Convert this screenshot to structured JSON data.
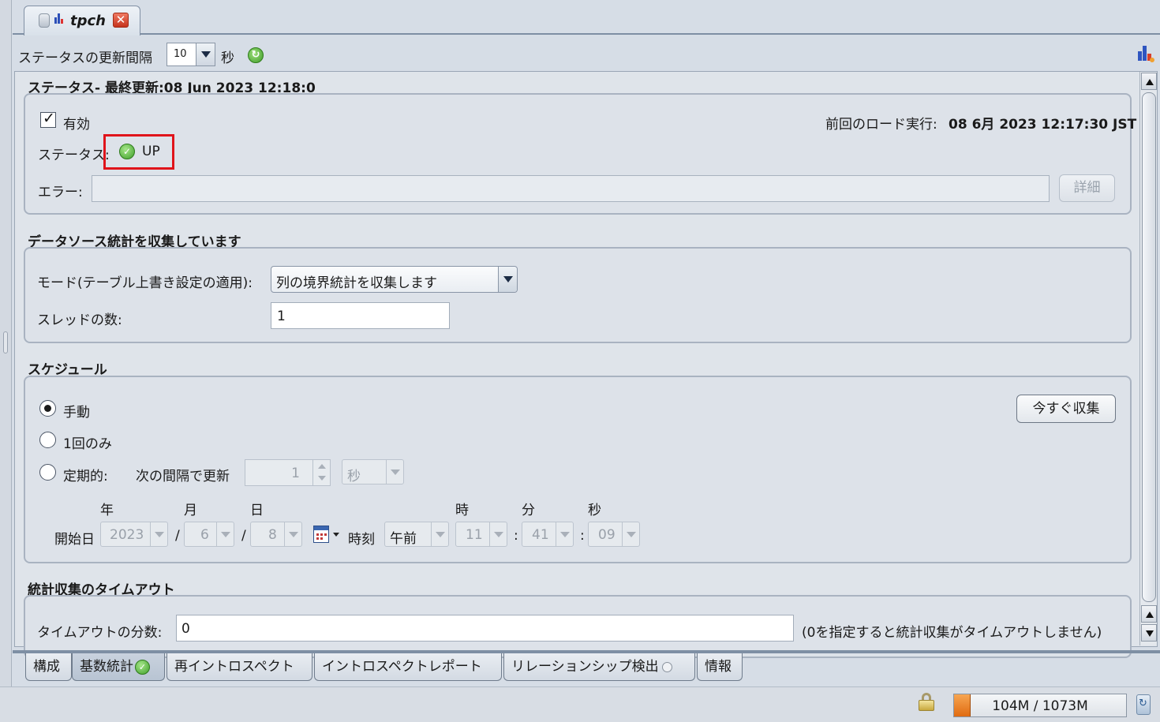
{
  "tab": {
    "title": "tpch",
    "close": "✕"
  },
  "refresh": {
    "label": "ステータスの更新間隔",
    "interval": "10",
    "unit": "秒"
  },
  "status_section": {
    "heading": "ステータス- 最終更新:08 Jun 2023 12:18:0",
    "enabled_label": "有効",
    "enabled_checked": true,
    "last_load_label": "前回のロード実行:",
    "last_load_value": "08 6月 2023 12:17:30 JST",
    "status_label": "ステータス:",
    "status_value": "UP",
    "status_color": "#3f9f2a",
    "error_label": "エラー:",
    "error_value": "",
    "details_button": "詳細"
  },
  "stats_section": {
    "heading": "データソース統計を収集しています",
    "mode_label": "モード(テーブル上書き設定の適用):",
    "mode_value": "列の境界統計を収集します",
    "threads_label": "スレッドの数:",
    "threads_value": "1"
  },
  "schedule_section": {
    "heading": "スケジュール",
    "manual_label": "手動",
    "once_label": "1回のみ",
    "periodic_label": "定期的:",
    "selected": "manual",
    "update_interval_label": "次の間隔で更新",
    "interval_value": "1",
    "interval_unit": "秒",
    "collect_now_button": "今すぐ収集",
    "col_year": "年",
    "col_month": "月",
    "col_day": "日",
    "col_hour": "時",
    "col_minute": "分",
    "col_second": "秒",
    "start_date_label": "開始日",
    "year": "2023",
    "month": "6",
    "day": "8",
    "date_sep": "/",
    "time_label": "時刻",
    "ampm": "午前",
    "hour": "11",
    "minute": "41",
    "second": "09",
    "time_sep": ":"
  },
  "timeout_section": {
    "heading": "統計収集のタイムアウト",
    "minutes_label": "タイムアウトの分数:",
    "minutes_value": "0",
    "hint": "(0を指定すると統計収集がタイムアウトしません)"
  },
  "bottom_tabs": [
    {
      "label": "構成"
    },
    {
      "label": "基数統計"
    },
    {
      "label": "再イントロスペクト"
    },
    {
      "label": "イントロスペクトレポート"
    },
    {
      "label": "リレーションシップ検出"
    },
    {
      "label": "情報"
    }
  ],
  "active_bottom_tab": "基数統計",
  "status_bar": {
    "memory": "104M / 1073M",
    "memory_used_fraction": 0.097
  },
  "colors": {
    "accent_highlight": "#e0141b",
    "memory_fill": "#e06a10"
  }
}
